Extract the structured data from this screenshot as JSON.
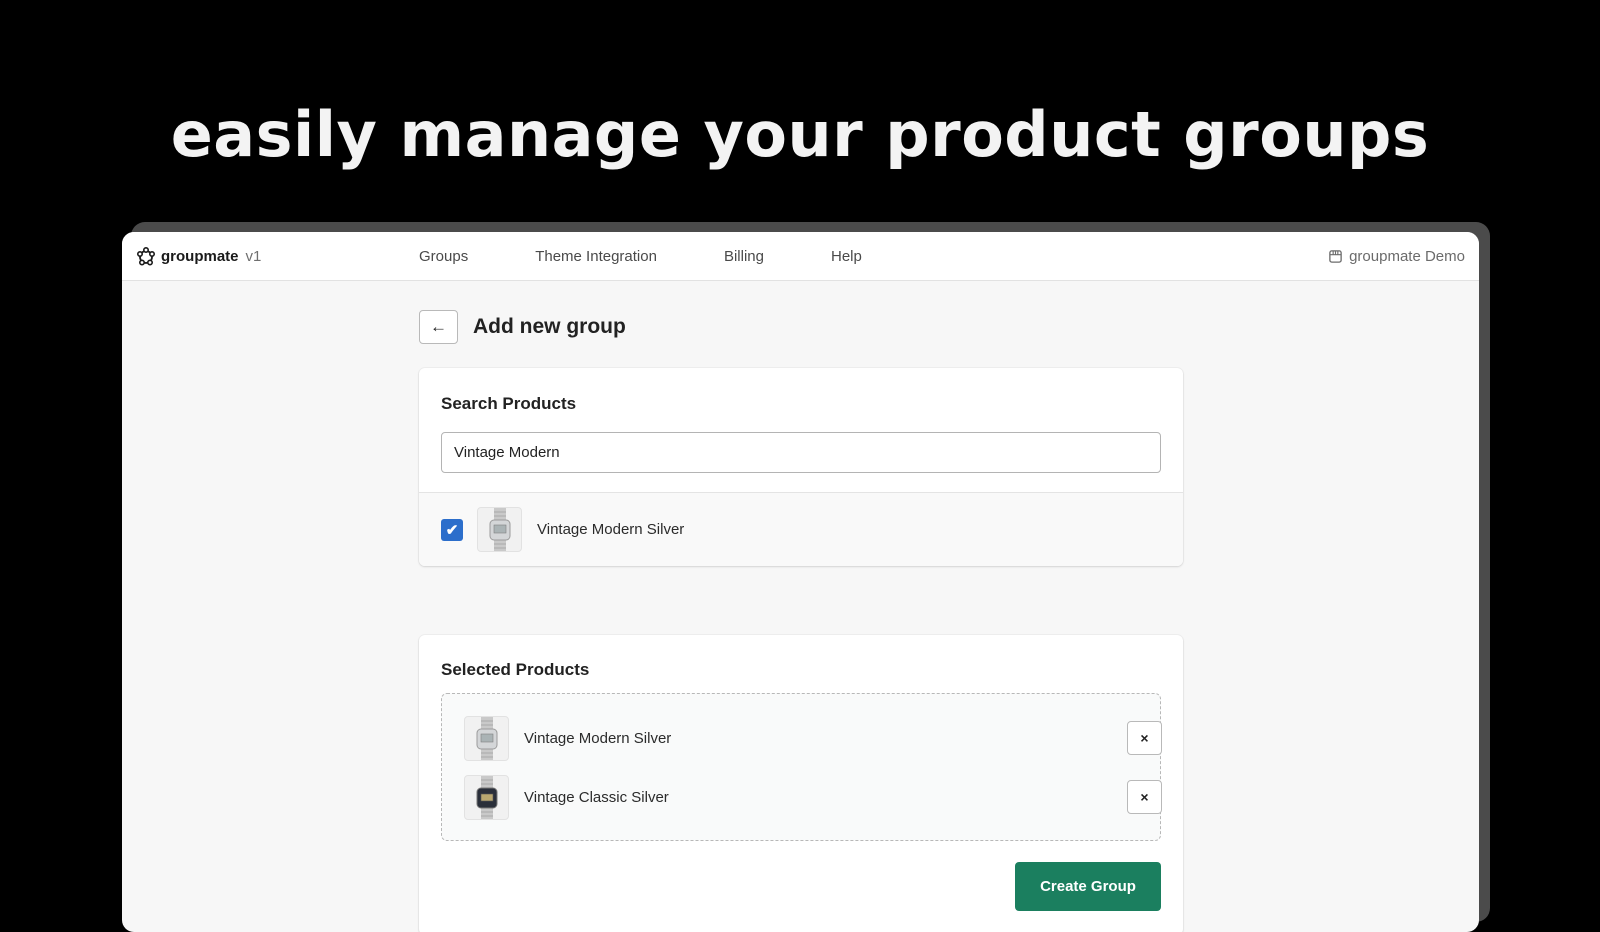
{
  "headline": "easily manage your product groups",
  "app": {
    "brand_name": "groupmate",
    "brand_version": "v1",
    "nav": [
      {
        "label": "Groups"
      },
      {
        "label": "Theme Integration"
      },
      {
        "label": "Billing"
      },
      {
        "label": "Help"
      }
    ],
    "store_name": "groupmate Demo"
  },
  "page": {
    "back_label": "←",
    "title": "Add new group"
  },
  "search": {
    "title": "Search Products",
    "value": "Vintage Modern",
    "results": [
      {
        "name": "Vintage Modern Silver",
        "checked": true,
        "check_glyph": "✔",
        "thumb": "silver-watch"
      }
    ]
  },
  "selected": {
    "title": "Selected Products",
    "items": [
      {
        "name": "Vintage Modern Silver",
        "remove_label": "×",
        "thumb": "silver-watch"
      },
      {
        "name": "Vintage Classic Silver",
        "remove_label": "×",
        "thumb": "black-face-watch"
      }
    ],
    "create_label": "Create Group"
  },
  "colors": {
    "accent_green": "#1b7f5f",
    "checkbox_blue": "#2c6ecb"
  }
}
